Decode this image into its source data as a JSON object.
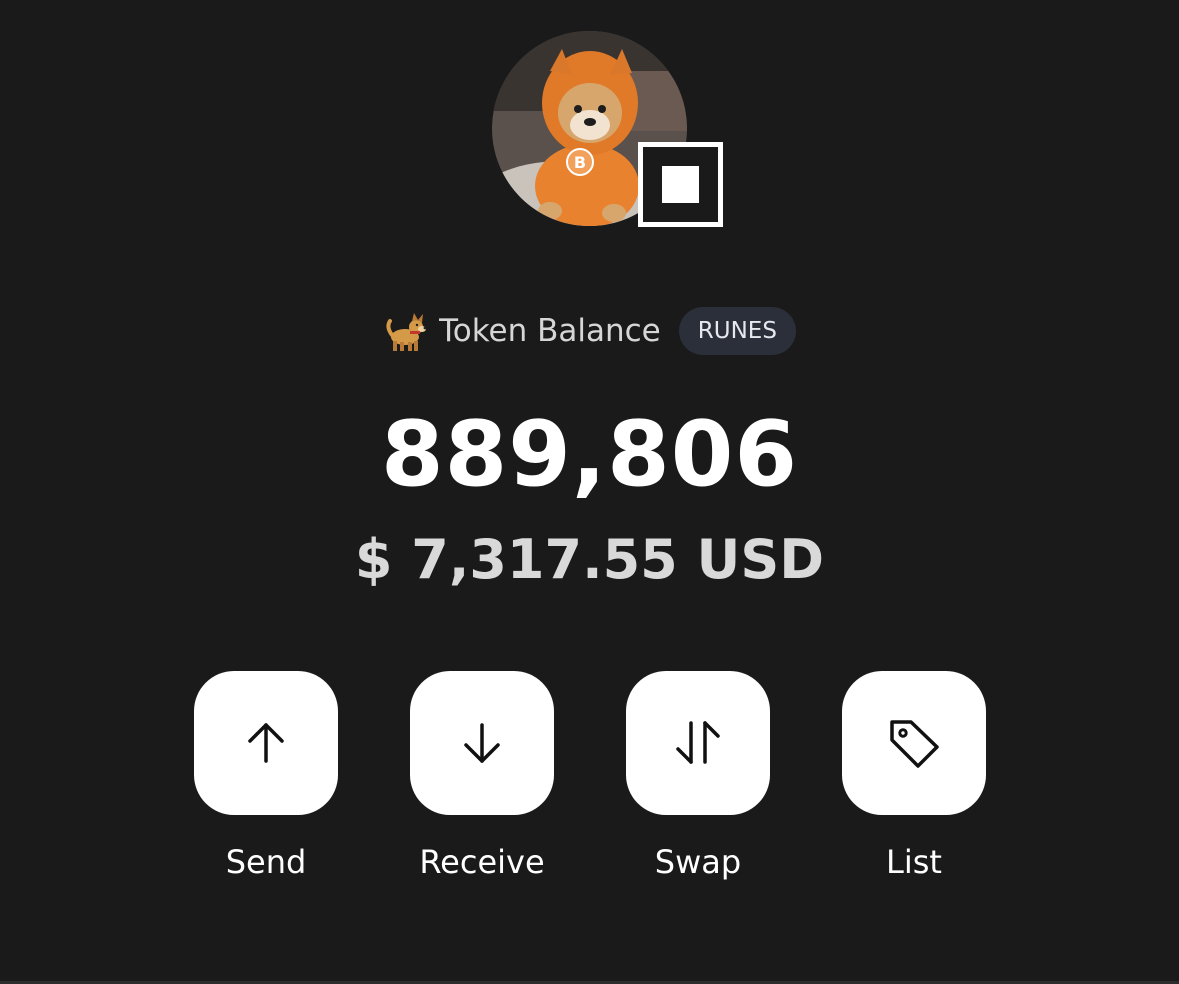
{
  "profile": {
    "avatar_icon": "doge-hoodie-avatar-icon",
    "badge_icon": "ordinal-square-icon"
  },
  "token": {
    "label_emoji_icon": "dog-emoji-icon",
    "label": "Token Balance",
    "standard_badge": "RUNES",
    "balance": "889,806",
    "usd_value": "$ 7,317.55 USD"
  },
  "actions": [
    {
      "label": "Send",
      "icon": "arrow-up-icon"
    },
    {
      "label": "Receive",
      "icon": "arrow-down-icon"
    },
    {
      "label": "Swap",
      "icon": "swap-arrows-icon"
    },
    {
      "label": "List",
      "icon": "tag-icon"
    }
  ],
  "colors": {
    "background": "#1a1a1a",
    "badge_bg": "#2b2f3a",
    "button_bg": "#ffffff",
    "avatar_hoodie": "#e8822e"
  }
}
